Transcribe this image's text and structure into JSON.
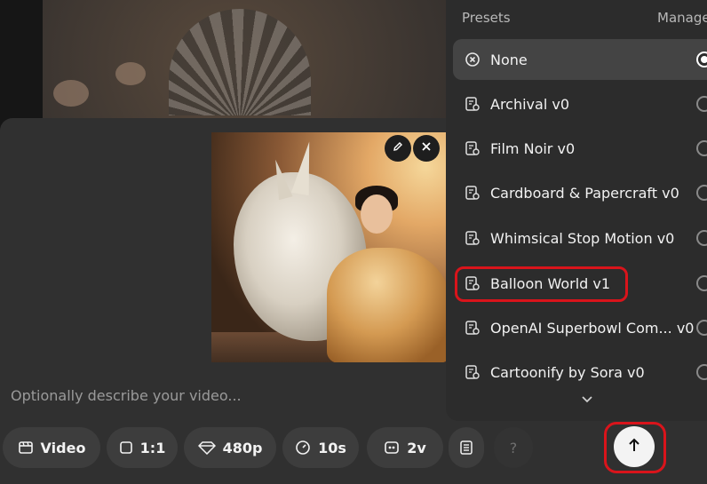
{
  "prompt": {
    "placeholder": "Optionally describe your video..."
  },
  "thumbnail": {
    "edit_icon": "pencil-icon",
    "remove_icon": "close-icon"
  },
  "toolbar": {
    "type_label": "Video",
    "aspect_label": "1:1",
    "resolution_label": "480p",
    "duration_label": "10s",
    "variations_label": "2v",
    "help_label": "?"
  },
  "presets": {
    "title": "Presets",
    "manage_label": "Manage",
    "items": [
      {
        "label": "None",
        "icon": "circle-x-icon",
        "selected": true
      },
      {
        "label": "Archival v0",
        "icon": "preset-icon"
      },
      {
        "label": "Film Noir v0",
        "icon": "preset-icon"
      },
      {
        "label": "Cardboard & Papercraft v0",
        "icon": "preset-icon"
      },
      {
        "label": "Whimsical Stop Motion v0",
        "icon": "preset-icon"
      },
      {
        "label": "Balloon World v1",
        "icon": "preset-icon",
        "annotated": true
      },
      {
        "label": "OpenAI Superbowl Com... v0",
        "icon": "preset-icon"
      },
      {
        "label": "Cartoonify by Sora v0",
        "icon": "preset-icon"
      }
    ]
  },
  "colors": {
    "annotation": "#d9141b",
    "panel": "#2c2c2c",
    "composer": "#303030"
  }
}
